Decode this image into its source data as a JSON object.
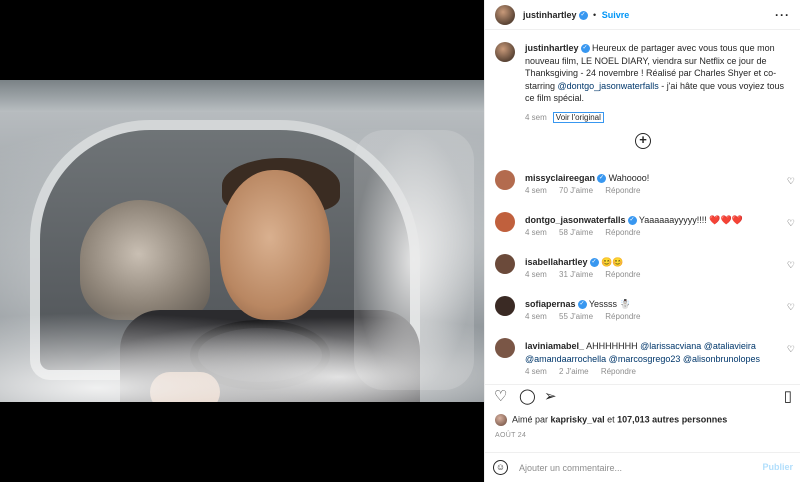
{
  "header": {
    "username": "justinhartley",
    "separator": "•",
    "follow_label": "Suivre",
    "more_icon": "more-dots-icon"
  },
  "caption": {
    "username": "justinhartley",
    "text_part1": "Heureux de partager avec vous tous que mon nouveau film, LE NOEL DIARY, viendra sur Netflix ce jour de Thanksgiving - 24 novembre ! Réalisé par Charles Shyer et co-starring ",
    "mention": "@dontgo_jasonwaterfalls",
    "text_part2": " - j'ai hâte que vous voyiez tous ce film spécial.",
    "time": "4 sem",
    "see_original": "Voir l'original"
  },
  "comments": [
    {
      "username": "missyclaireegan",
      "verified": true,
      "text": "Wahoooo!",
      "time": "4 sem",
      "likes": "70 J'aime",
      "reply": "Répondre",
      "avatar_color": "#b36b4e"
    },
    {
      "username": "dontgo_jasonwaterfalls",
      "verified": true,
      "text": "Yaaaaaayyyyy!!!! ❤️❤️❤️",
      "time": "4 sem",
      "likes": "58 J'aime",
      "reply": "Répondre",
      "avatar_color": "#c0603d"
    },
    {
      "username": "isabellahartley",
      "verified": true,
      "text": "😊😊",
      "time": "4 sem",
      "likes": "31 J'aime",
      "reply": "Répondre",
      "avatar_color": "#6b4a3a"
    },
    {
      "username": "sofiapernas",
      "verified": true,
      "text": "Yessss ☃️",
      "time": "4 sem",
      "likes": "55 J'aime",
      "reply": "Répondre",
      "avatar_color": "#3a2a24"
    },
    {
      "username": "laviniamabel_",
      "verified": false,
      "text": "AHHHHHHH",
      "mentions": "@larissacviana @ataliavieira @amandaarrochella @marcosgrego23 @alisonbrunolopes",
      "time": "4 sem",
      "likes": "2 J'aime",
      "reply": "Répondre",
      "avatar_color": "#7a5646"
    }
  ],
  "actions": {
    "like_icon": "heart-icon",
    "comment_icon": "comment-icon",
    "share_icon": "share-icon",
    "save_icon": "bookmark-icon"
  },
  "likes": {
    "prefix": "Aimé par",
    "user": "kaprisky_val",
    "middle": "et",
    "count_text": "107,013 autres personnes"
  },
  "date": "AOÛT 24",
  "add_comment": {
    "placeholder": "Ajouter un commentaire...",
    "publish_label": "Publier"
  },
  "colors": {
    "accent": "#0095f6",
    "verified": "#3897f0",
    "text": "#262626",
    "muted": "#8e8e8e"
  }
}
